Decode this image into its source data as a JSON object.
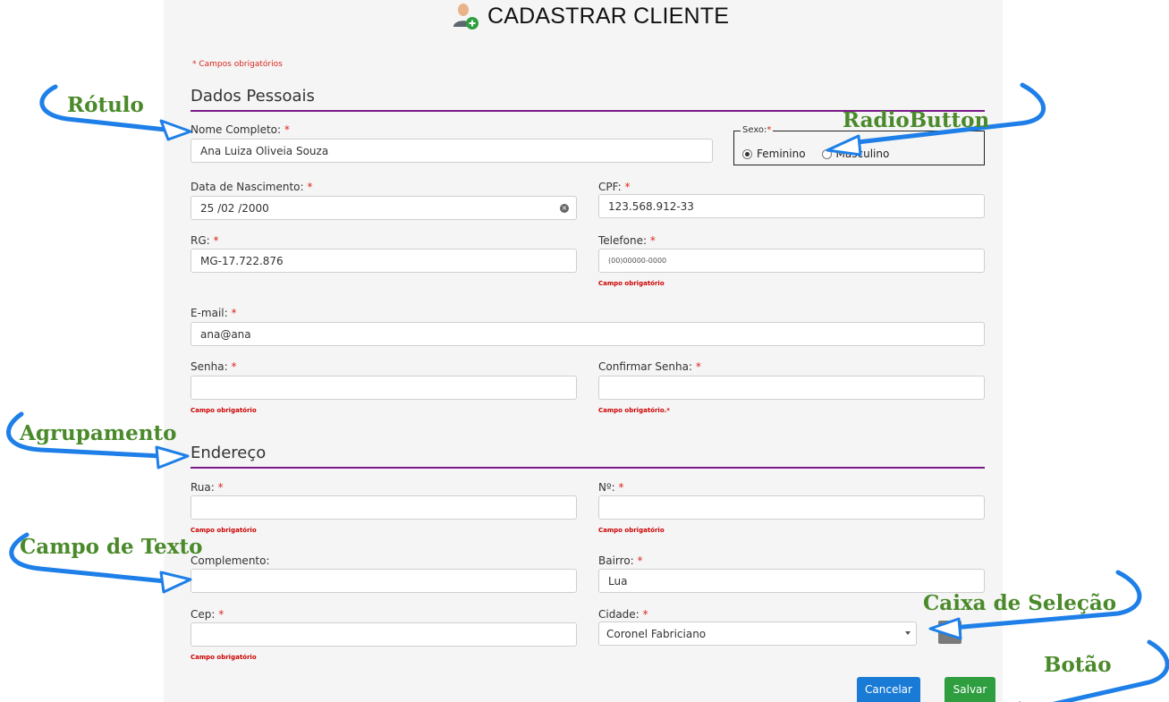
{
  "page": {
    "title": "CADASTRAR CLIENTE",
    "required_note": "* Campos obrigatórios"
  },
  "sections": {
    "personal": "Dados Pessoais",
    "address": "Endereço"
  },
  "required_mark": "*",
  "fields": {
    "nome": {
      "label": "Nome Completo:",
      "value": "Ana Luiza Oliveia Souza"
    },
    "sexo": {
      "legend": "Sexo:",
      "options": [
        "Feminino",
        "Masculino"
      ],
      "selected": "Feminino"
    },
    "nascimento": {
      "label": "Data de Nascimento:",
      "value": "25 /02 /2000"
    },
    "cpf": {
      "label": "CPF:",
      "value": "123.568.912-33"
    },
    "rg": {
      "label": "RG:",
      "value": "MG-17.722.876"
    },
    "telefone": {
      "label": "Telefone:",
      "placeholder": "(00)00000-0000",
      "error": "Campo obrigatório"
    },
    "email": {
      "label": "E-mail:",
      "value": "ana@ana"
    },
    "senha": {
      "label": "Senha:",
      "value": "",
      "error": "Campo obrigatório"
    },
    "confirmar_senha": {
      "label": "Confirmar Senha:",
      "value": "",
      "error": "Campo obrigatório.*"
    },
    "rua": {
      "label": "Rua:",
      "value": "",
      "error": "Campo obrigatório"
    },
    "numero": {
      "label": "Nº:",
      "value": "",
      "error": "Campo obrigatório"
    },
    "complemento": {
      "label": "Complemento:",
      "value": ""
    },
    "bairro": {
      "label": "Bairro:",
      "value": "Lua"
    },
    "cep": {
      "label": "Cep:",
      "value": "",
      "error": "Campo obrigatório"
    },
    "cidade": {
      "label": "Cidade:",
      "value": "Coronel Fabriciano"
    }
  },
  "buttons": {
    "cancel": "Cancelar",
    "save": "Salvar"
  },
  "annotations": {
    "rotulo": "Rótulo",
    "radiobutton": "RadioButton",
    "agrupamento": "Agrupamento",
    "campo_texto": "Campo de Texto",
    "caixa_selecao": "Caixa de Seleção",
    "botao": "Botão"
  },
  "colors": {
    "section_line": "#7b1a8a",
    "required": "#d9281f",
    "cancel_button": "#1a7bd6",
    "save_button": "#2e9e3f",
    "annotation_text": "#4a8a2a",
    "annotation_arrow": "#1e7fe8"
  },
  "icons": {
    "title": "add-user-icon",
    "clear": "clear-circle-icon",
    "select": "chevron-down-icon",
    "add_city": "add-icon"
  }
}
